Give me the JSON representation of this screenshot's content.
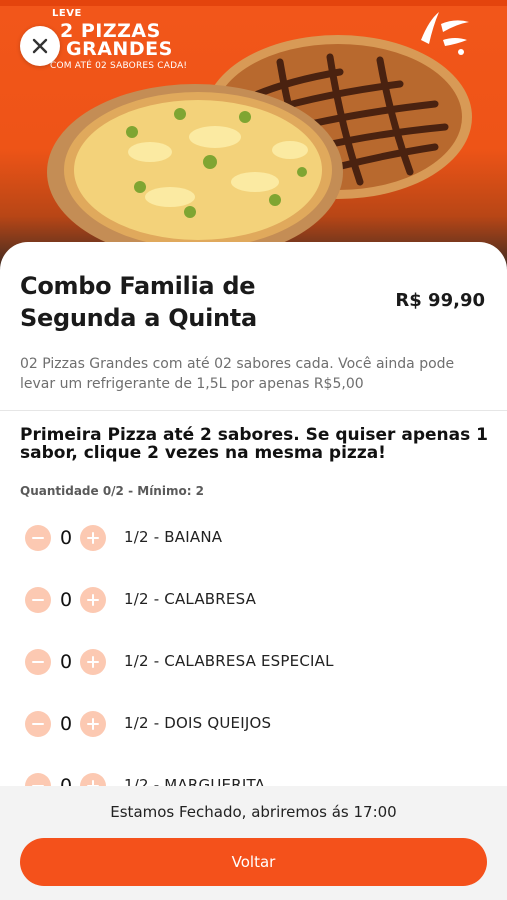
{
  "hero": {
    "promo_kicker": "LEVE",
    "promo_line1": "2 PIZZAS",
    "promo_line2": "GRANDES",
    "promo_sub": "COM ATÉ 02 SABORES CADA!",
    "close_icon": "close-icon",
    "image": "two-pizzas-photo"
  },
  "product": {
    "title": "Combo Familia de Segunda a Quinta",
    "price": "R$ 99,90",
    "description": "02 Pizzas Grandes com até 02 sabores cada. Você ainda pode levar um refrigerante de 1,5L por apenas R$5,00"
  },
  "section": {
    "title": "Primeira Pizza até 2 sabores. Se quiser apenas 1 sabor, clique 2 vezes na mesma pizza!",
    "quantity_info": "Quantidade 0/2 - Mínimo: 2",
    "options": [
      {
        "label": "1/2 - BAIANA",
        "count": "0"
      },
      {
        "label": "1/2 - CALABRESA",
        "count": "0"
      },
      {
        "label": "1/2 - CALABRESA ESPECIAL",
        "count": "0"
      },
      {
        "label": "1/2 - DOIS QUEIJOS",
        "count": "0"
      },
      {
        "label": "1/2 - MARGUERITA",
        "count": "0"
      }
    ]
  },
  "footer": {
    "closed_message": "Estamos Fechado, abriremos ás 17:00",
    "back_label": "Voltar"
  },
  "colors": {
    "accent": "#f4511b",
    "stepper_bg": "#fcc9b2",
    "footer_bg": "#f3f3f3"
  }
}
